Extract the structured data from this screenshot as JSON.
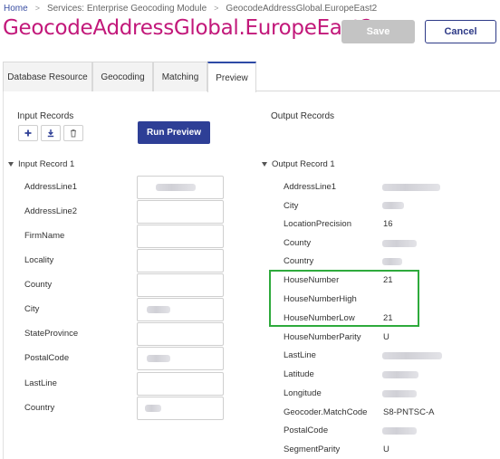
{
  "breadcrumb": {
    "home": "Home",
    "services": "Services: Enterprise Geocoding Module",
    "current": "GeocodeAddressGlobal.EuropeEast2"
  },
  "page": {
    "title": "GeocodeAddressGlobal.EuropeEast2"
  },
  "actions": {
    "save_label": "Save",
    "cancel_label": "Cancel"
  },
  "tabs": [
    {
      "label": "Database Resource"
    },
    {
      "label": "Geocoding"
    },
    {
      "label": "Matching"
    },
    {
      "label": "Preview"
    }
  ],
  "input": {
    "section_title": "Input Records",
    "run_label": "Run Preview",
    "record_title": "Input Record 1",
    "fields": [
      {
        "label": "AddressLine1"
      },
      {
        "label": "AddressLine2"
      },
      {
        "label": "FirmName"
      },
      {
        "label": "Locality"
      },
      {
        "label": "County"
      },
      {
        "label": "City"
      },
      {
        "label": "StateProvince"
      },
      {
        "label": "PostalCode"
      },
      {
        "label": "LastLine"
      },
      {
        "label": "Country"
      }
    ]
  },
  "output": {
    "section_title": "Output Records",
    "record_title": "Output Record 1",
    "fields": [
      {
        "label": "AddressLine1",
        "value": ""
      },
      {
        "label": "City",
        "value": ""
      },
      {
        "label": "LocationPrecision",
        "value": "16"
      },
      {
        "label": "County",
        "value": ""
      },
      {
        "label": "Country",
        "value": ""
      },
      {
        "label": "HouseNumber",
        "value": "21"
      },
      {
        "label": "HouseNumberHigh",
        "value": ""
      },
      {
        "label": "HouseNumberLow",
        "value": "21"
      },
      {
        "label": "HouseNumberParity",
        "value": "U"
      },
      {
        "label": "LastLine",
        "value": ""
      },
      {
        "label": "Latitude",
        "value": ""
      },
      {
        "label": "Longitude",
        "value": ""
      },
      {
        "label": "Geocoder.MatchCode",
        "value": "S8-PNTSC-A"
      },
      {
        "label": "PostalCode",
        "value": ""
      },
      {
        "label": "SegmentParity",
        "value": "U"
      }
    ]
  },
  "colors": {
    "title": "#c2187a",
    "primary_button": "#2e3f96",
    "highlight": "#2eaa3c",
    "active_tab": "#2e4aa6"
  }
}
